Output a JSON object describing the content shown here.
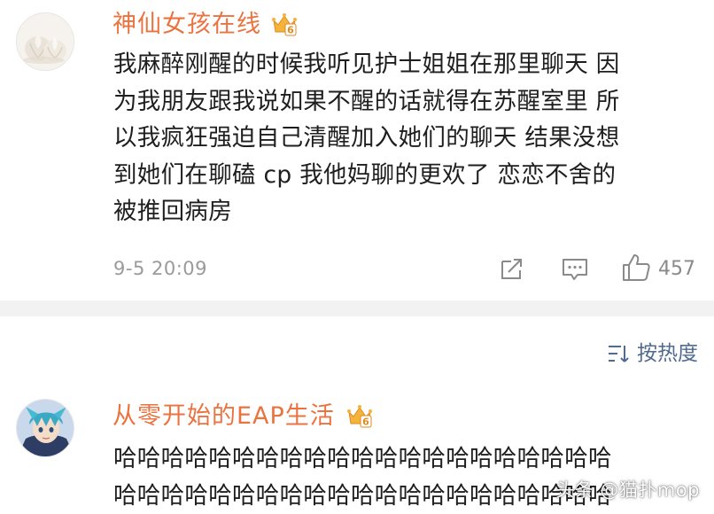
{
  "comments": [
    {
      "username": "神仙女孩在线",
      "badge_icon": "crown-badge-icon",
      "badge_level": "6",
      "lines": [
        "我麻醉刚醒的时候我听见护士姐姐在那里聊天 因",
        "为我朋友跟我说如果不醒的话就得在苏醒室里 所",
        "以我疯狂强迫自己清醒加入她们的聊天 结果没想",
        "到她们在聊磕 cp 我他妈聊的更欢了 恋恋不舍的",
        "被推回病房"
      ],
      "time": "9-5 20:09",
      "like_count": "457"
    },
    {
      "username": "从零开始的EAP生活",
      "badge_icon": "crown-badge-icon",
      "badge_level": "6",
      "lines": [
        "哈哈哈哈哈哈哈哈哈哈哈哈哈哈哈哈哈哈哈哈哈",
        "哈哈哈哈哈哈哈哈哈哈哈哈哈哈哈哈哈哈哈哈哈"
      ]
    }
  ],
  "sort": {
    "label": "按热度",
    "icon": "sort-icon"
  },
  "watermark": "头条 @猫扑mop",
  "colors": {
    "username": "#eb7340",
    "link_blue": "#506b8f",
    "meta_gray": "#9a9a9a",
    "divider": "#f2f2f2"
  }
}
